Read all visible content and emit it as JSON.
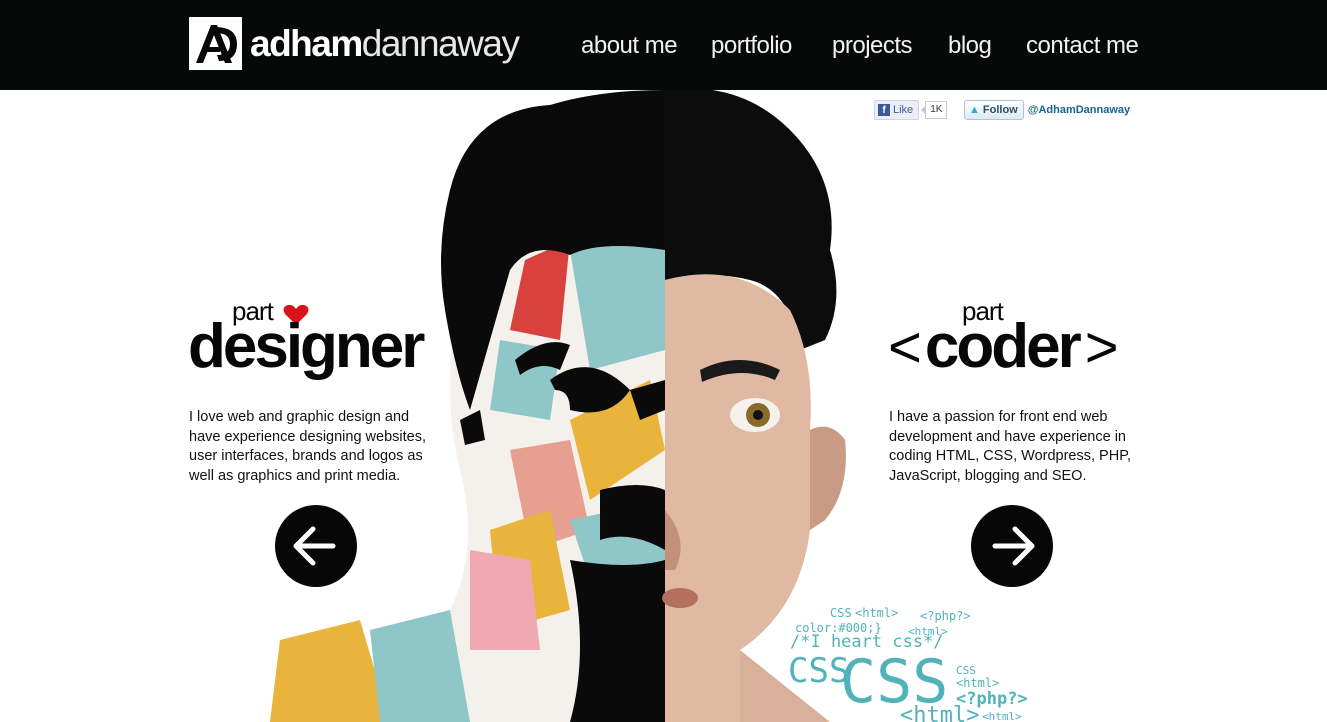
{
  "header": {
    "logo_bold": "adham",
    "logo_light": "dannaway",
    "nav": [
      {
        "label": "about me"
      },
      {
        "label": "portfolio"
      },
      {
        "label": "projects"
      },
      {
        "label": "blog"
      },
      {
        "label": "contact me"
      }
    ]
  },
  "social": {
    "like_label": "Like",
    "like_count": "1K",
    "follow_label": "Follow",
    "twitter_handle": "@AdhamDannaway"
  },
  "designer": {
    "part": "part",
    "title": "designer",
    "text": "I love web and graphic design and have experience designing websites, user interfaces, brands and logos as well as graphics and print media."
  },
  "coder": {
    "part": "part",
    "title": "coder",
    "bracket_open": "<",
    "bracket_close": ">",
    "text": "I have a passion for front end web development and have experience in coding HTML, CSS, Wordpress, PHP, JavaScript, blogging and SEO."
  },
  "code_cloud": [
    "CSS",
    "<html>",
    "<?php?>",
    "color:#000;}",
    "<html>",
    "/*I heart css*/",
    "CSS",
    "CSS",
    "CSS",
    "<html>",
    "<?php?>",
    "<html>",
    "<html>"
  ],
  "colors": {
    "header_bg": "#070808",
    "heart": "#d7141c",
    "code_teal": "#4fb3b9"
  }
}
